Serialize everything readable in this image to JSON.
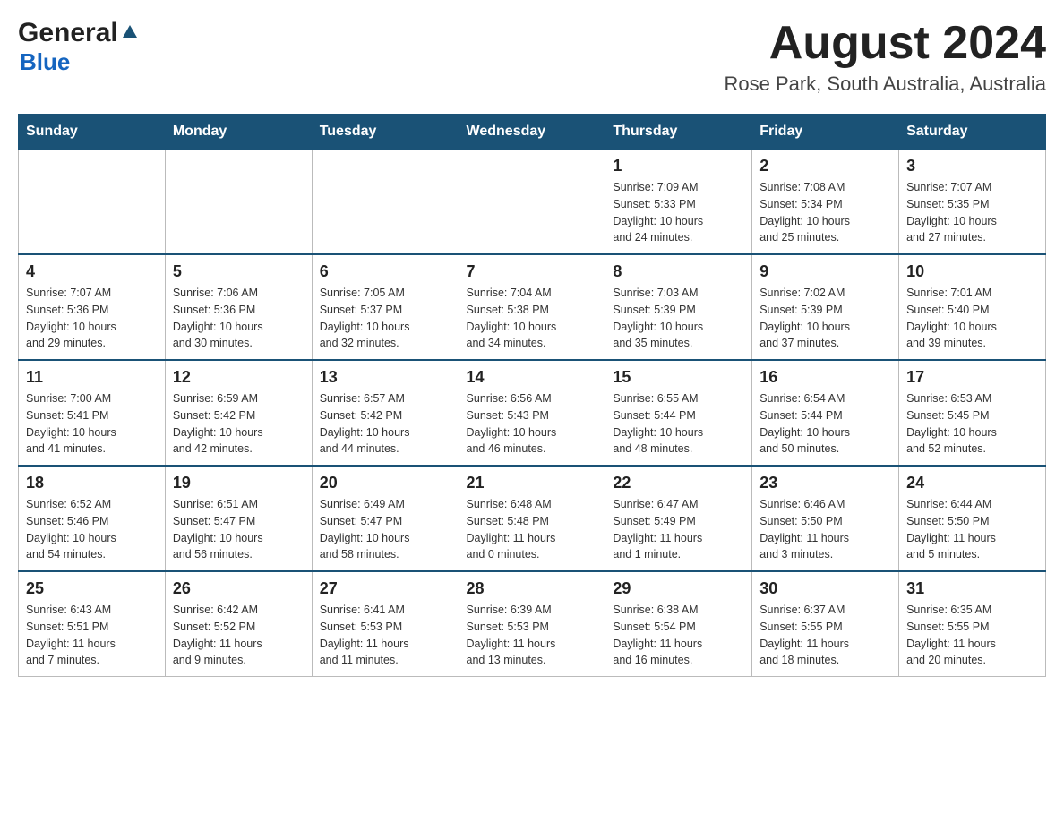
{
  "header": {
    "logo": {
      "general": "General",
      "blue": "Blue"
    },
    "title": "August 2024",
    "location": "Rose Park, South Australia, Australia"
  },
  "days_of_week": [
    "Sunday",
    "Monday",
    "Tuesday",
    "Wednesday",
    "Thursday",
    "Friday",
    "Saturday"
  ],
  "weeks": [
    {
      "days": [
        {
          "num": "",
          "info": ""
        },
        {
          "num": "",
          "info": ""
        },
        {
          "num": "",
          "info": ""
        },
        {
          "num": "",
          "info": ""
        },
        {
          "num": "1",
          "info": "Sunrise: 7:09 AM\nSunset: 5:33 PM\nDaylight: 10 hours\nand 24 minutes."
        },
        {
          "num": "2",
          "info": "Sunrise: 7:08 AM\nSunset: 5:34 PM\nDaylight: 10 hours\nand 25 minutes."
        },
        {
          "num": "3",
          "info": "Sunrise: 7:07 AM\nSunset: 5:35 PM\nDaylight: 10 hours\nand 27 minutes."
        }
      ]
    },
    {
      "days": [
        {
          "num": "4",
          "info": "Sunrise: 7:07 AM\nSunset: 5:36 PM\nDaylight: 10 hours\nand 29 minutes."
        },
        {
          "num": "5",
          "info": "Sunrise: 7:06 AM\nSunset: 5:36 PM\nDaylight: 10 hours\nand 30 minutes."
        },
        {
          "num": "6",
          "info": "Sunrise: 7:05 AM\nSunset: 5:37 PM\nDaylight: 10 hours\nand 32 minutes."
        },
        {
          "num": "7",
          "info": "Sunrise: 7:04 AM\nSunset: 5:38 PM\nDaylight: 10 hours\nand 34 minutes."
        },
        {
          "num": "8",
          "info": "Sunrise: 7:03 AM\nSunset: 5:39 PM\nDaylight: 10 hours\nand 35 minutes."
        },
        {
          "num": "9",
          "info": "Sunrise: 7:02 AM\nSunset: 5:39 PM\nDaylight: 10 hours\nand 37 minutes."
        },
        {
          "num": "10",
          "info": "Sunrise: 7:01 AM\nSunset: 5:40 PM\nDaylight: 10 hours\nand 39 minutes."
        }
      ]
    },
    {
      "days": [
        {
          "num": "11",
          "info": "Sunrise: 7:00 AM\nSunset: 5:41 PM\nDaylight: 10 hours\nand 41 minutes."
        },
        {
          "num": "12",
          "info": "Sunrise: 6:59 AM\nSunset: 5:42 PM\nDaylight: 10 hours\nand 42 minutes."
        },
        {
          "num": "13",
          "info": "Sunrise: 6:57 AM\nSunset: 5:42 PM\nDaylight: 10 hours\nand 44 minutes."
        },
        {
          "num": "14",
          "info": "Sunrise: 6:56 AM\nSunset: 5:43 PM\nDaylight: 10 hours\nand 46 minutes."
        },
        {
          "num": "15",
          "info": "Sunrise: 6:55 AM\nSunset: 5:44 PM\nDaylight: 10 hours\nand 48 minutes."
        },
        {
          "num": "16",
          "info": "Sunrise: 6:54 AM\nSunset: 5:44 PM\nDaylight: 10 hours\nand 50 minutes."
        },
        {
          "num": "17",
          "info": "Sunrise: 6:53 AM\nSunset: 5:45 PM\nDaylight: 10 hours\nand 52 minutes."
        }
      ]
    },
    {
      "days": [
        {
          "num": "18",
          "info": "Sunrise: 6:52 AM\nSunset: 5:46 PM\nDaylight: 10 hours\nand 54 minutes."
        },
        {
          "num": "19",
          "info": "Sunrise: 6:51 AM\nSunset: 5:47 PM\nDaylight: 10 hours\nand 56 minutes."
        },
        {
          "num": "20",
          "info": "Sunrise: 6:49 AM\nSunset: 5:47 PM\nDaylight: 10 hours\nand 58 minutes."
        },
        {
          "num": "21",
          "info": "Sunrise: 6:48 AM\nSunset: 5:48 PM\nDaylight: 11 hours\nand 0 minutes."
        },
        {
          "num": "22",
          "info": "Sunrise: 6:47 AM\nSunset: 5:49 PM\nDaylight: 11 hours\nand 1 minute."
        },
        {
          "num": "23",
          "info": "Sunrise: 6:46 AM\nSunset: 5:50 PM\nDaylight: 11 hours\nand 3 minutes."
        },
        {
          "num": "24",
          "info": "Sunrise: 6:44 AM\nSunset: 5:50 PM\nDaylight: 11 hours\nand 5 minutes."
        }
      ]
    },
    {
      "days": [
        {
          "num": "25",
          "info": "Sunrise: 6:43 AM\nSunset: 5:51 PM\nDaylight: 11 hours\nand 7 minutes."
        },
        {
          "num": "26",
          "info": "Sunrise: 6:42 AM\nSunset: 5:52 PM\nDaylight: 11 hours\nand 9 minutes."
        },
        {
          "num": "27",
          "info": "Sunrise: 6:41 AM\nSunset: 5:53 PM\nDaylight: 11 hours\nand 11 minutes."
        },
        {
          "num": "28",
          "info": "Sunrise: 6:39 AM\nSunset: 5:53 PM\nDaylight: 11 hours\nand 13 minutes."
        },
        {
          "num": "29",
          "info": "Sunrise: 6:38 AM\nSunset: 5:54 PM\nDaylight: 11 hours\nand 16 minutes."
        },
        {
          "num": "30",
          "info": "Sunrise: 6:37 AM\nSunset: 5:55 PM\nDaylight: 11 hours\nand 18 minutes."
        },
        {
          "num": "31",
          "info": "Sunrise: 6:35 AM\nSunset: 5:55 PM\nDaylight: 11 hours\nand 20 minutes."
        }
      ]
    }
  ]
}
